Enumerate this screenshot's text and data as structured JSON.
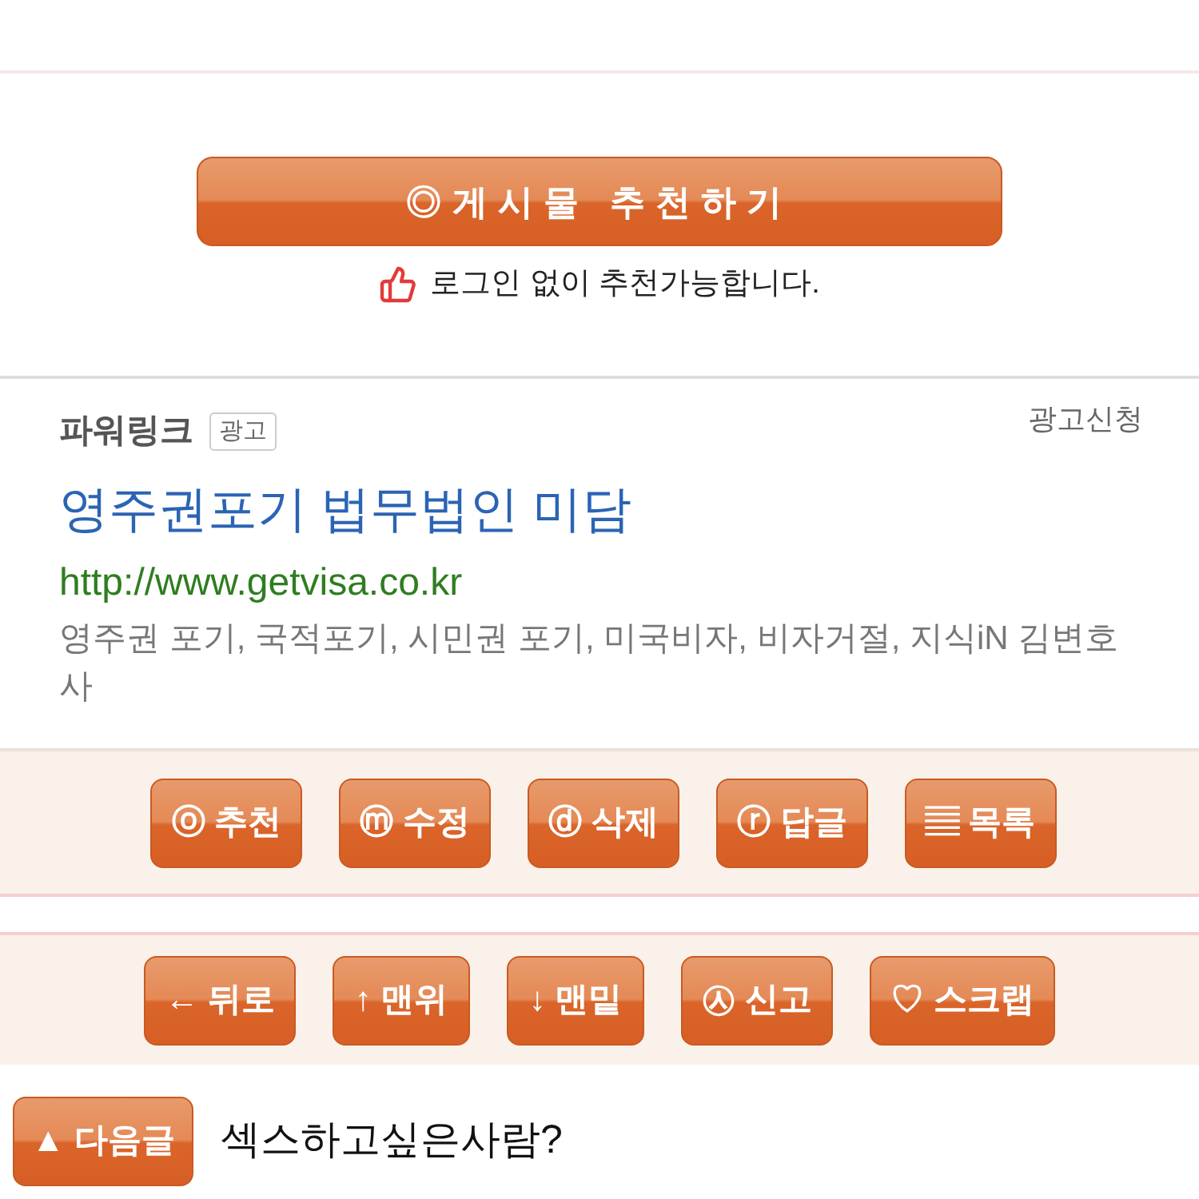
{
  "recommend": {
    "button": "◎게시물 추천하기",
    "note": "로그인 없이 추천가능합니다."
  },
  "power_link": {
    "title": "파워링크",
    "badge": "광고",
    "apply_link": "광고신청",
    "ad": {
      "title": "영주권포기 법무법인 미담",
      "url": "http://www.getvisa.co.kr",
      "description": "영주권 포기, 국적포기, 시민권 포기, 미국비자, 비자거절, 지식iN 김변호사"
    }
  },
  "action_bar": [
    {
      "label": "ⓞ 추천"
    },
    {
      "label": "ⓜ 수정"
    },
    {
      "label": "ⓓ 삭제"
    },
    {
      "label": "ⓡ 답글"
    },
    {
      "label": "▤ 목록"
    }
  ],
  "nav_bar": [
    {
      "label": "← 뒤로"
    },
    {
      "label": "↑ 맨위"
    },
    {
      "label": "↓ 맨밑"
    },
    {
      "label": "㉦ 신고"
    },
    {
      "label": "♡ 스크랩"
    }
  ],
  "next_post": {
    "button": "▲ 다음글",
    "title": "섹스하고싶은사람?"
  }
}
